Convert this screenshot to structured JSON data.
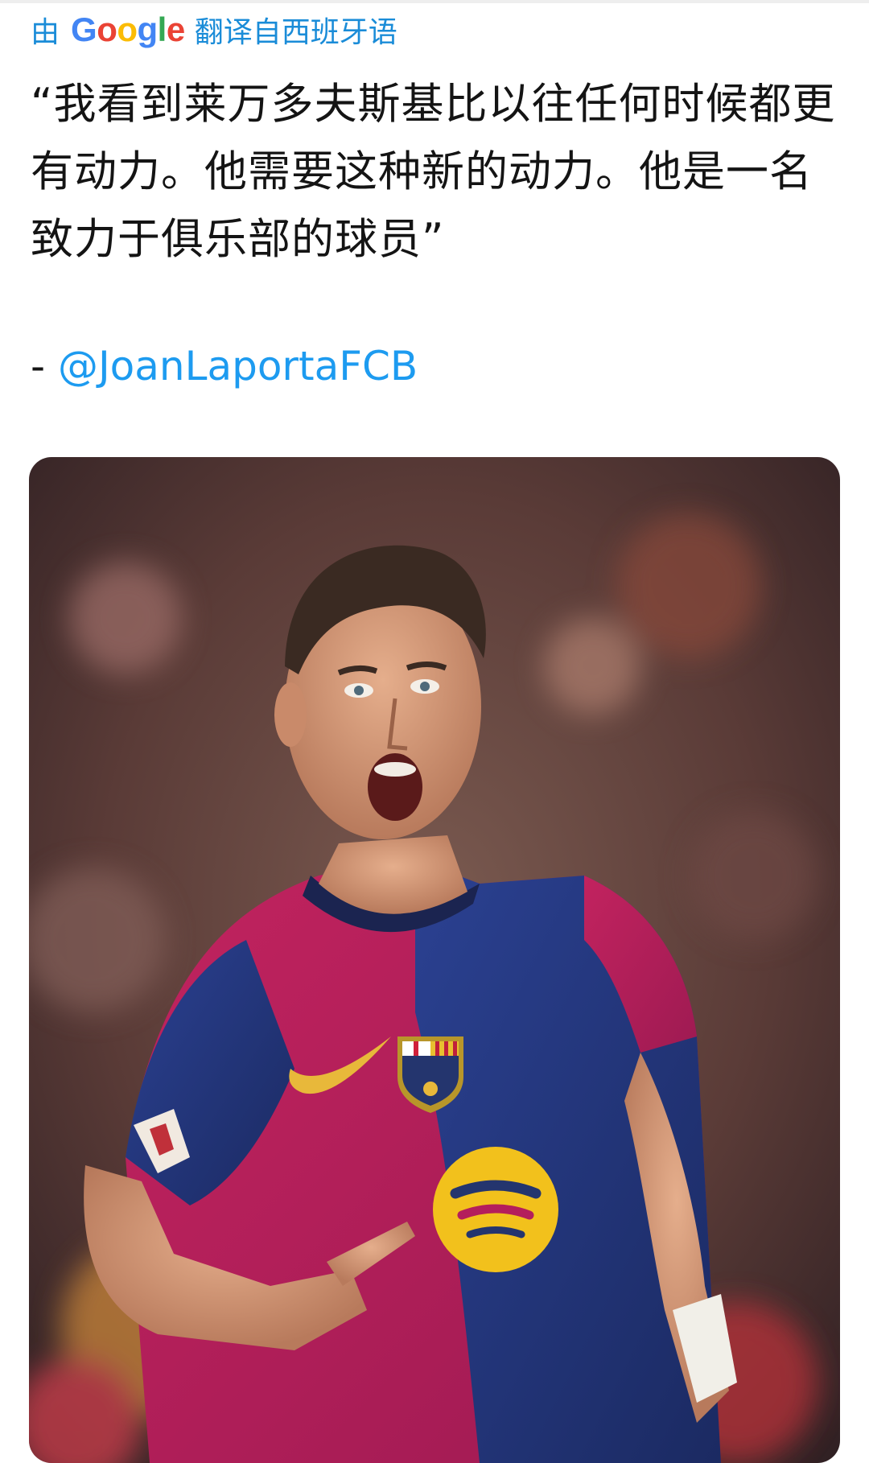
{
  "translation": {
    "prefix": "由",
    "provider_letters": [
      {
        "ch": "G",
        "color": "#4285f4"
      },
      {
        "ch": "o",
        "color": "#ea4335"
      },
      {
        "ch": "o",
        "color": "#fbbc05"
      },
      {
        "ch": "g",
        "color": "#4285f4"
      },
      {
        "ch": "l",
        "color": "#34a853"
      },
      {
        "ch": "e",
        "color": "#ea4335"
      }
    ],
    "suffix": "翻译自西班牙语"
  },
  "post": {
    "quote": "“我看到莱万多夫斯基比以往任何时候都更有动力。他需要这种新的动力。他是一名致力于俱乐部的球员”",
    "attribution_dash": "- ",
    "attribution_handle": "@JoanLaportaFCB"
  },
  "image": {
    "subject": "footballer celebrating in Barcelona home kit",
    "colors": {
      "kit_blue": "#24356e",
      "kit_garnet": "#b41e5c",
      "sponsor_yellow": "#f2c11c",
      "link_blue": "#1d9bf0"
    }
  }
}
